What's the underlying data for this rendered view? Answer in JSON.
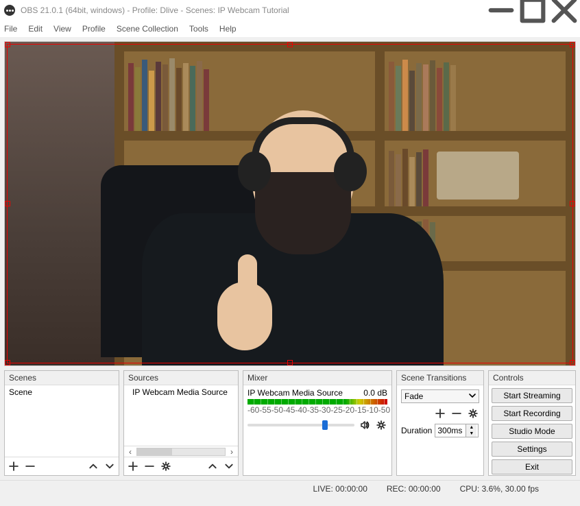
{
  "window": {
    "title": "OBS 21.0.1 (64bit, windows) - Profile: Dlive - Scenes: IP Webcam Tutorial"
  },
  "menu": {
    "items": [
      "File",
      "Edit",
      "View",
      "Profile",
      "Scene Collection",
      "Tools",
      "Help"
    ]
  },
  "panels": {
    "scenes": {
      "title": "Scenes",
      "items": [
        "Scene"
      ]
    },
    "sources": {
      "title": "Sources",
      "items": [
        "IP Webcam Media Source"
      ]
    },
    "mixer": {
      "title": "Mixer",
      "source": "IP Webcam Media Source",
      "db": "0.0 dB",
      "ticks": [
        "-60",
        "-55",
        "-50",
        "-45",
        "-40",
        "-35",
        "-30",
        "-25",
        "-20",
        "-15",
        "-10",
        "-5",
        "0"
      ]
    },
    "transitions": {
      "title": "Scene Transitions",
      "selected": "Fade",
      "duration_label": "Duration",
      "duration_value": "300ms"
    },
    "controls": {
      "title": "Controls",
      "buttons": [
        "Start Streaming",
        "Start Recording",
        "Studio Mode",
        "Settings",
        "Exit"
      ]
    }
  },
  "status": {
    "live": "LIVE: 00:00:00",
    "rec": "REC: 00:00:00",
    "cpu": "CPU: 3.6%, 30.00 fps"
  }
}
